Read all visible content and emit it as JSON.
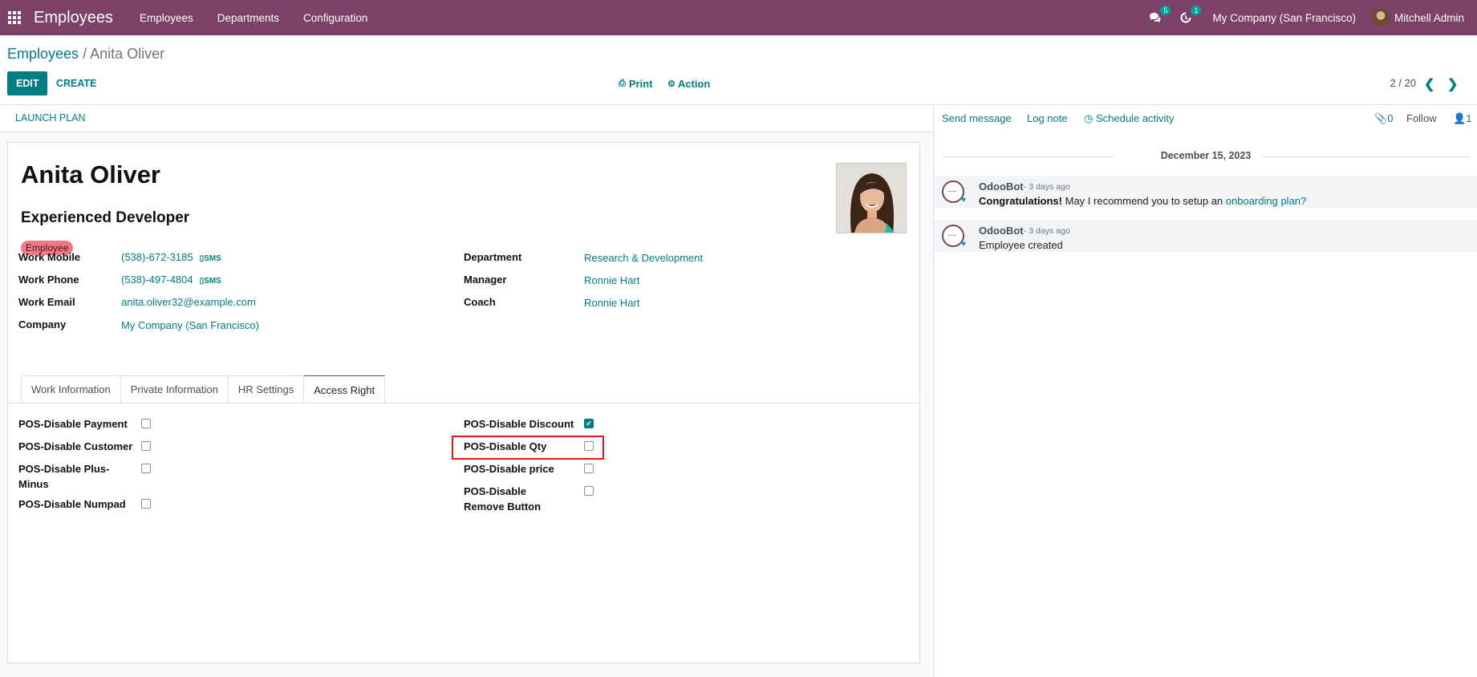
{
  "navbar": {
    "app_name": "Employees",
    "menu": [
      "Employees",
      "Departments",
      "Configuration"
    ],
    "messages_badge": "5",
    "activities_badge": "1",
    "company": "My Company (San Francisco)",
    "user": "Mitchell Admin",
    "brand_color": "#7c4168"
  },
  "breadcrumb": {
    "parent": "Employees",
    "separator": "/",
    "current": "Anita Oliver"
  },
  "control": {
    "edit": "EDIT",
    "create": "CREATE",
    "print": "Print",
    "action": "Action",
    "pager": "2 / 20"
  },
  "statusbar": {
    "launch_plan": "LAUNCH PLAN"
  },
  "employee": {
    "name": "Anita Oliver",
    "job_title": "Experienced Developer",
    "tag": "Employee",
    "fields_left": [
      {
        "label": "Work Mobile",
        "value": "(538)-672-3185",
        "sms": "SMS"
      },
      {
        "label": "Work Phone",
        "value": "(538)-497-4804",
        "sms": "SMS"
      },
      {
        "label": "Work Email",
        "value": "anita.oliver32@example.com"
      },
      {
        "label": "Company",
        "value": "My Company (San Francisco)"
      }
    ],
    "fields_right": [
      {
        "label": "Department",
        "value": "Research & Development"
      },
      {
        "label": "Manager",
        "value": "Ronnie Hart"
      },
      {
        "label": "Coach",
        "value": "Ronnie Hart"
      }
    ]
  },
  "tabs": [
    "Work Information",
    "Private Information",
    "HR Settings",
    "Access Right"
  ],
  "active_tab": "Access Right",
  "access_rights": {
    "left": [
      {
        "label": "POS-Disable Payment",
        "checked": false
      },
      {
        "label": "POS-Disable Customer",
        "checked": false
      },
      {
        "label": "POS-Disable Plus-Minus",
        "checked": false
      },
      {
        "label": "POS-Disable Numpad",
        "checked": false
      }
    ],
    "right": [
      {
        "label": "POS-Disable Discount",
        "checked": true
      },
      {
        "label": "POS-Disable Qty",
        "checked": false
      },
      {
        "label": "POS-Disable price",
        "checked": false
      },
      {
        "label": "POS-Disable Remove Button",
        "checked": false
      }
    ]
  },
  "chatter": {
    "send_message": "Send message",
    "log_note": "Log note",
    "schedule_activity": "Schedule activity",
    "attachments": "0",
    "follow": "Follow",
    "followers": "1",
    "date": "December 15, 2023",
    "messages": [
      {
        "author": "OdooBot",
        "date": "- 3 days ago",
        "bold": "Congratulations!",
        "text": " May I recommend you to setup an ",
        "link": "onboarding plan?"
      },
      {
        "author": "OdooBot",
        "date": "- 3 days ago",
        "text": "Employee created"
      }
    ]
  },
  "accent_color": "#017e84"
}
